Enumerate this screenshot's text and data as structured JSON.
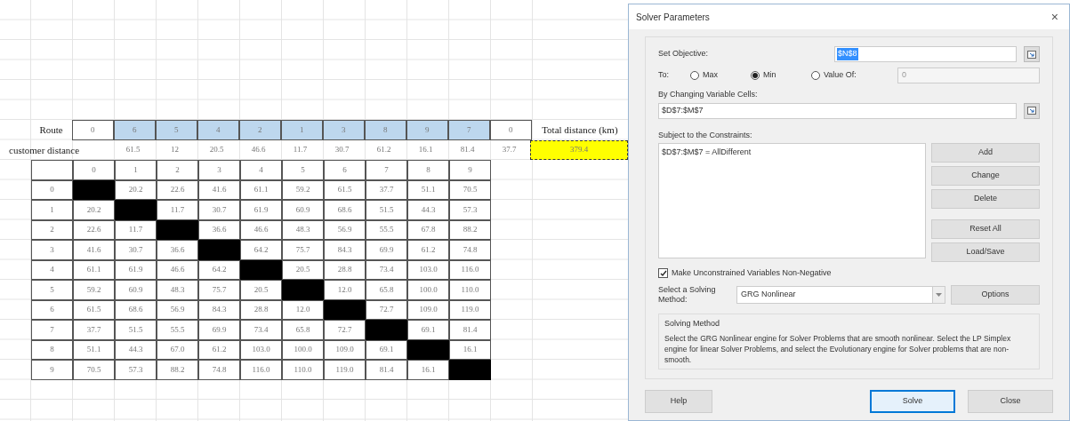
{
  "sheet": {
    "route_label": "Route",
    "route": [
      {
        "value": "0",
        "highlighted": false
      },
      {
        "value": "6",
        "highlighted": true
      },
      {
        "value": "5",
        "highlighted": true
      },
      {
        "value": "4",
        "highlighted": true
      },
      {
        "value": "2",
        "highlighted": true
      },
      {
        "value": "1",
        "highlighted": true
      },
      {
        "value": "3",
        "highlighted": true
      },
      {
        "value": "8",
        "highlighted": true
      },
      {
        "value": "9",
        "highlighted": true
      },
      {
        "value": "7",
        "highlighted": true
      },
      {
        "value": "0",
        "highlighted": false
      }
    ],
    "total_label": "Total distance (km)",
    "distance_label": "customer distance",
    "distances": [
      "61.5",
      "12",
      "20.5",
      "46.6",
      "11.7",
      "30.7",
      "61.2",
      "16.1",
      "81.4",
      "37.7"
    ],
    "total_value": "379.4",
    "matrix_headers": [
      "0",
      "1",
      "2",
      "3",
      "4",
      "5",
      "6",
      "7",
      "8",
      "9"
    ],
    "matrix_rows": [
      {
        "label": "0",
        "cells": [
          {
            "kind": "blocked"
          },
          {
            "kind": "value",
            "text": "20.2"
          },
          {
            "kind": "value",
            "text": "22.6"
          },
          {
            "kind": "value",
            "text": "41.6"
          },
          {
            "kind": "value",
            "text": "61.1"
          },
          {
            "kind": "value",
            "text": "59.2"
          },
          {
            "kind": "value",
            "text": "61.5"
          },
          {
            "kind": "value",
            "text": "37.7"
          },
          {
            "kind": "value",
            "text": "51.1"
          },
          {
            "kind": "value",
            "text": "70.5"
          }
        ]
      },
      {
        "label": "1",
        "cells": [
          {
            "kind": "value",
            "text": "20.2"
          },
          {
            "kind": "blocked"
          },
          {
            "kind": "value",
            "text": "11.7"
          },
          {
            "kind": "value",
            "text": "30.7"
          },
          {
            "kind": "value",
            "text": "61.9"
          },
          {
            "kind": "value",
            "text": "60.9"
          },
          {
            "kind": "value",
            "text": "68.6"
          },
          {
            "kind": "value",
            "text": "51.5"
          },
          {
            "kind": "value",
            "text": "44.3"
          },
          {
            "kind": "value",
            "text": "57.3"
          }
        ]
      },
      {
        "label": "2",
        "cells": [
          {
            "kind": "value",
            "text": "22.6"
          },
          {
            "kind": "value",
            "text": "11.7"
          },
          {
            "kind": "blocked"
          },
          {
            "kind": "value",
            "text": "36.6"
          },
          {
            "kind": "value",
            "text": "46.6"
          },
          {
            "kind": "value",
            "text": "48.3"
          },
          {
            "kind": "value",
            "text": "56.9"
          },
          {
            "kind": "value",
            "text": "55.5"
          },
          {
            "kind": "value",
            "text": "67.8"
          },
          {
            "kind": "value",
            "text": "88.2"
          }
        ]
      },
      {
        "label": "3",
        "cells": [
          {
            "kind": "value",
            "text": "41.6"
          },
          {
            "kind": "value",
            "text": "30.7"
          },
          {
            "kind": "value",
            "text": "36.6"
          },
          {
            "kind": "blocked"
          },
          {
            "kind": "value",
            "text": "64.2"
          },
          {
            "kind": "value",
            "text": "75.7"
          },
          {
            "kind": "value",
            "text": "84.3"
          },
          {
            "kind": "value",
            "text": "69.9"
          },
          {
            "kind": "value",
            "text": "61.2"
          },
          {
            "kind": "value",
            "text": "74.8"
          }
        ]
      },
      {
        "label": "4",
        "cells": [
          {
            "kind": "value",
            "text": "61.1"
          },
          {
            "kind": "value",
            "text": "61.9"
          },
          {
            "kind": "value",
            "text": "46.6"
          },
          {
            "kind": "value",
            "text": "64.2"
          },
          {
            "kind": "blocked"
          },
          {
            "kind": "value",
            "text": "20.5"
          },
          {
            "kind": "value",
            "text": "28.8"
          },
          {
            "kind": "value",
            "text": "73.4"
          },
          {
            "kind": "value",
            "text": "103.0"
          },
          {
            "kind": "value",
            "text": "116.0"
          }
        ]
      },
      {
        "label": "5",
        "cells": [
          {
            "kind": "value",
            "text": "59.2"
          },
          {
            "kind": "value",
            "text": "60.9"
          },
          {
            "kind": "value",
            "text": "48.3"
          },
          {
            "kind": "value",
            "text": "75.7"
          },
          {
            "kind": "value",
            "text": "20.5"
          },
          {
            "kind": "blocked"
          },
          {
            "kind": "value",
            "text": "12.0"
          },
          {
            "kind": "value",
            "text": "65.8"
          },
          {
            "kind": "value",
            "text": "100.0"
          },
          {
            "kind": "value",
            "text": "110.0"
          }
        ]
      },
      {
        "label": "6",
        "cells": [
          {
            "kind": "value",
            "text": "61.5"
          },
          {
            "kind": "value",
            "text": "68.6"
          },
          {
            "kind": "value",
            "text": "56.9"
          },
          {
            "kind": "value",
            "text": "84.3"
          },
          {
            "kind": "value",
            "text": "28.8"
          },
          {
            "kind": "value",
            "text": "12.0"
          },
          {
            "kind": "blocked"
          },
          {
            "kind": "value",
            "text": "72.7"
          },
          {
            "kind": "value",
            "text": "109.0"
          },
          {
            "kind": "value",
            "text": "119.0"
          }
        ]
      },
      {
        "label": "7",
        "cells": [
          {
            "kind": "value",
            "text": "37.7"
          },
          {
            "kind": "value",
            "text": "51.5"
          },
          {
            "kind": "value",
            "text": "55.5"
          },
          {
            "kind": "value",
            "text": "69.9"
          },
          {
            "kind": "value",
            "text": "73.4"
          },
          {
            "kind": "value",
            "text": "65.8"
          },
          {
            "kind": "value",
            "text": "72.7"
          },
          {
            "kind": "blocked"
          },
          {
            "kind": "value",
            "text": "69.1"
          },
          {
            "kind": "value",
            "text": "81.4"
          }
        ]
      },
      {
        "label": "8",
        "cells": [
          {
            "kind": "value",
            "text": "51.1"
          },
          {
            "kind": "value",
            "text": "44.3"
          },
          {
            "kind": "value",
            "text": "67.0"
          },
          {
            "kind": "value",
            "text": "61.2"
          },
          {
            "kind": "value",
            "text": "103.0"
          },
          {
            "kind": "value",
            "text": "100.0"
          },
          {
            "kind": "value",
            "text": "109.0"
          },
          {
            "kind": "value",
            "text": "69.1"
          },
          {
            "kind": "blocked"
          },
          {
            "kind": "value",
            "text": "16.1"
          }
        ]
      },
      {
        "label": "9",
        "cells": [
          {
            "kind": "value",
            "text": "70.5"
          },
          {
            "kind": "value",
            "text": "57.3"
          },
          {
            "kind": "value",
            "text": "88.2"
          },
          {
            "kind": "value",
            "text": "74.8"
          },
          {
            "kind": "value",
            "text": "116.0"
          },
          {
            "kind": "value",
            "text": "110.0"
          },
          {
            "kind": "value",
            "text": "119.0"
          },
          {
            "kind": "value",
            "text": "81.4"
          },
          {
            "kind": "value",
            "text": "16.1"
          },
          {
            "kind": "blocked"
          }
        ]
      }
    ]
  },
  "dialog": {
    "title": "Solver Parameters",
    "close": "×",
    "objective_label": "Set Objective:",
    "objective_value": "$N$8",
    "to_label": "To:",
    "targets": [
      {
        "label": "Max",
        "selected": false
      },
      {
        "label": "Min",
        "selected": true
      },
      {
        "label": "Value Of:",
        "selected": false
      }
    ],
    "value_of": "0",
    "changing_label": "By Changing Variable Cells:",
    "changing_value": "$D$7:$M$7",
    "constraints_label": "Subject to the Constraints:",
    "constraints": [
      "$D$7:$M$7 = AllDifferent"
    ],
    "side_buttons": [
      "Add",
      "Change",
      "Delete",
      "Reset All",
      "Load/Save"
    ],
    "nonneg": {
      "label": "Make Unconstrained Variables Non-Negative",
      "checked": true
    },
    "method_label": "Select a Solving Method:",
    "method": "GRG Nonlinear",
    "options": "Options",
    "help_title": "Solving Method",
    "help_text": "Select the GRG Nonlinear engine for Solver Problems that are smooth nonlinear. Select the LP Simplex engine for linear Solver Problems, and select the Evolutionary engine for Solver problems that are non-smooth.",
    "footer": [
      {
        "label": "Help",
        "kind": "normal"
      },
      {
        "label": "Solve",
        "kind": "default"
      },
      {
        "label": "Close",
        "kind": "normal"
      }
    ]
  }
}
